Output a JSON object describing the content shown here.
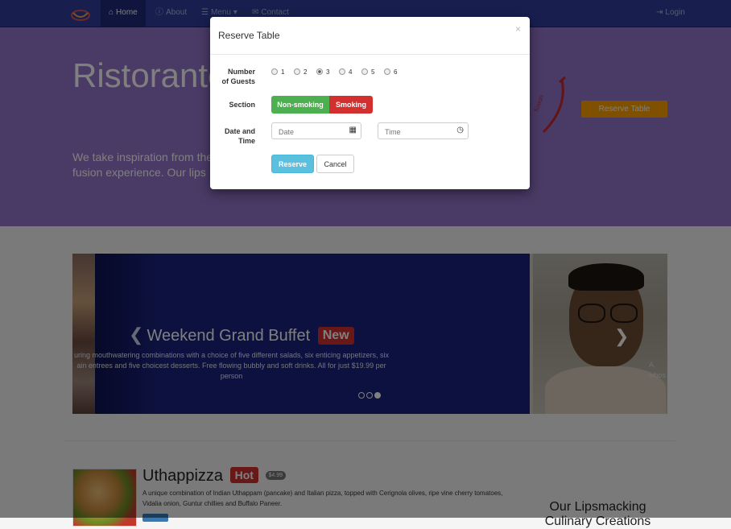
{
  "navbar": {
    "home": "Home",
    "about": "About",
    "menu": "Menu",
    "contact": "Contact",
    "login": "Login"
  },
  "jumbotron": {
    "title": "Ristorante",
    "lead_line1": "We take inspiration from the",
    "lead_line2": "fusion experience. Our lips",
    "logo_text": "fusion",
    "reserve_button": "Reserve Table"
  },
  "carousel": {
    "title": "Weekend Grand Buffet",
    "badge": "New",
    "caption_line1": "uring mouthwatering combinations with a choice of five different salads, six enticing appetizers, six",
    "caption_line2": "ain entrees and five choicest desserts. Free flowing bubbly and soft drinks. All for just $19.99 per",
    "caption_line3": "person",
    "side_line1": "A",
    "side_line2": "whos",
    "slide_count": 3,
    "active_slide": 3
  },
  "menu_item": {
    "name": "Uthappizza",
    "badge": "Hot",
    "price": "$4.99",
    "description": "A unique combination of Indian Uthappam (pancake) and Italian pizza, topped with Cerignola olives, ripe vine cherry tomatoes, Vidalia onion, Guntur chillies and Buffalo Paneer."
  },
  "sidebar": {
    "heading_line1": "Our Lipsmacking",
    "heading_line2": "Culinary Creations"
  },
  "modal": {
    "title": "Reserve Table",
    "close": "×",
    "guests_label_1": "Number",
    "guests_label_2": "of Guests",
    "guest_options": [
      "1",
      "2",
      "3",
      "4",
      "5",
      "6"
    ],
    "selected_guests": "3",
    "section_label": "Section",
    "non_smoking": "Non-smoking",
    "smoking": "Smoking",
    "datetime_label_1": "Date and",
    "datetime_label_2": "Time",
    "date_placeholder": "Date",
    "time_placeholder": "Time",
    "reserve_button": "Reserve",
    "cancel_button": "Cancel"
  },
  "colors": {
    "navbar": "#303f9f",
    "jumbotron": "#9575cd",
    "carousel": "#1a237e",
    "accent_amber": "#ffa000",
    "success": "#4caf50",
    "danger": "#d32f2f",
    "info": "#5bc0de"
  }
}
